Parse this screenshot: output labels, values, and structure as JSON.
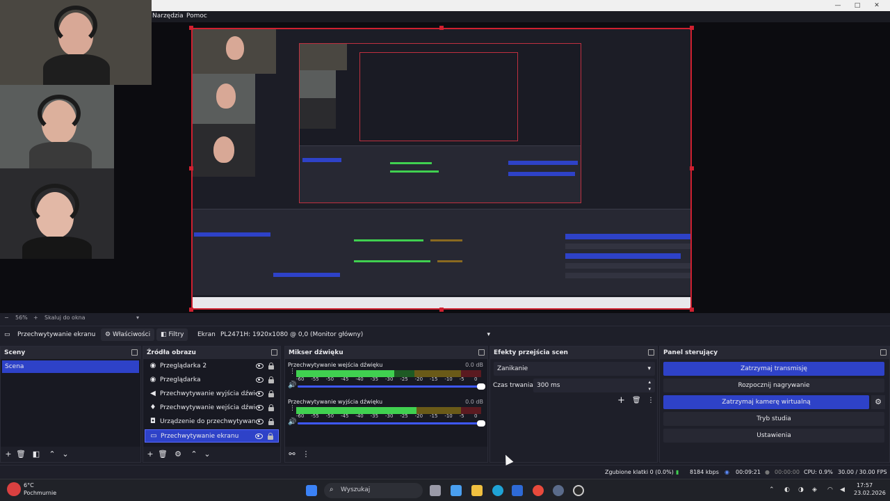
{
  "menu": {
    "tools": "Narzędzia",
    "help": "Pomoc"
  },
  "window": {
    "minimize_icon": "minimize-icon",
    "maximize_icon": "maximize-icon",
    "close_icon": "close-icon"
  },
  "zoom": {
    "level": "56%",
    "fit_label": "Skaluj do okna"
  },
  "source_toolbar": {
    "selected_source": "Przechwytywanie ekranu",
    "properties": "Właściwości",
    "filters": "Filtry",
    "display_label": "Ekran",
    "display_value": "PL2471H: 1920x1080 @ 0,0 (Monitor główny)"
  },
  "docks": {
    "scenes": {
      "title": "Sceny",
      "items": [
        "Scena"
      ]
    },
    "sources": {
      "title": "Źródła obrazu",
      "items": [
        {
          "label": "Przeglądarka 2",
          "icon": "browser-icon"
        },
        {
          "label": "Przeglądarka",
          "icon": "browser-icon"
        },
        {
          "label": "Przechwytywanie wyjścia dźwięku",
          "icon": "speaker-icon"
        },
        {
          "label": "Przechwytywanie wejścia dźwięku",
          "icon": "microphone-icon"
        },
        {
          "label": "Urządzenie do przechwytywania wideo",
          "icon": "camera-icon"
        },
        {
          "label": "Przechwytywanie ekranu",
          "icon": "monitor-icon"
        }
      ]
    },
    "mixer": {
      "title": "Mikser dźwięku",
      "ticks": [
        "-60",
        "-55",
        "-50",
        "-45",
        "-40",
        "-35",
        "-30",
        "-25",
        "-20",
        "-15",
        "-10",
        "-5",
        "0"
      ],
      "channels": [
        {
          "name": "Przechwytywanie wejścia dźwięku",
          "db": "0.0 dB",
          "level": 0.53,
          "volume": 1.0
        },
        {
          "name": "Przechwytywanie wyjścia dźwięku",
          "db": "0.0 dB",
          "level": 0.65,
          "volume": 1.0
        }
      ]
    },
    "transitions": {
      "title": "Efekty przejścia scen",
      "transition": "Zanikanie",
      "duration_label": "Czas trwania",
      "duration_value": "300 ms"
    },
    "controls": {
      "title": "Panel sterujący",
      "stop_stream": "Zatrzymaj transmisję",
      "start_recording": "Rozpocznij nagrywanie",
      "stop_virtual_cam": "Zatrzymaj kamerę wirtualną",
      "studio_mode": "Tryb studia",
      "settings": "Ustawienia"
    }
  },
  "status": {
    "dropped_frames": "Zgubione klatki 0 (0.0%)",
    "bitrate": "8184 kbps",
    "stream_time": "00:09:21",
    "rec_time": "00:00:00",
    "cpu": "CPU: 0.9%",
    "fps": "30.00 / 30.00 FPS"
  },
  "taskbar": {
    "weather_temp": "6°C",
    "weather_desc": "Pochmurnie",
    "search_placeholder": "Wyszukaj",
    "time": "17:57",
    "date": "23.02.2026"
  },
  "colors": {
    "accent": "#2e42c8",
    "frame": "#d02030",
    "meter_green": "#40d050"
  }
}
